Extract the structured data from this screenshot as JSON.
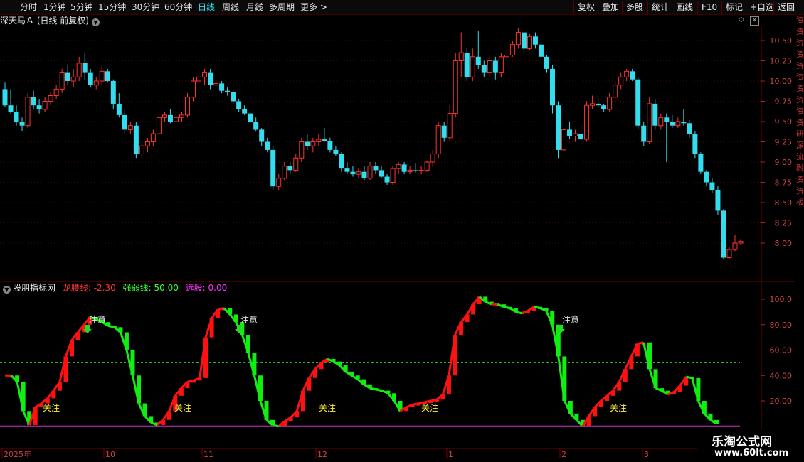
{
  "toolbar": {
    "timeframes": [
      "分时",
      "1分钟",
      "5分钟",
      "15分钟",
      "30分钟",
      "60分钟",
      "日线",
      "周线",
      "月线",
      "多周期",
      "更多 >"
    ],
    "active_timeframe": "日线",
    "right_buttons": [
      "复权",
      "叠加",
      "多股",
      "统计",
      "画线",
      "F10",
      "标记",
      "+自选",
      "返回"
    ]
  },
  "stock_title": "深天马Ａ (日线 前复权)",
  "main_axis_labels": [
    "10.50",
    "10.25",
    "10.00",
    "9.75",
    "9.50",
    "9.25",
    "9.00",
    "8.75",
    "8.50",
    "8.25",
    "8.00"
  ],
  "indicator": {
    "name": "股朋指标网",
    "lines": [
      {
        "label": "龙腰线:",
        "value": "-2.30",
        "color": "#ff3333"
      },
      {
        "label": "强弱线:",
        "value": "50.00",
        "color": "#33ff33"
      },
      {
        "label": "选股:",
        "value": "0.00",
        "color": "#ff33ff"
      }
    ],
    "axis_labels": [
      "100.0",
      "80.00",
      "60.00",
      "40.00",
      "20.00"
    ],
    "annotations": {
      "alert": "注意",
      "watch": "关注"
    }
  },
  "date_labels": [
    "2025年",
    "10",
    "11",
    "12",
    "1",
    "2",
    "3"
  ],
  "right_side_chars": "资资资资资资资资资资研深流融资资板",
  "watermark": {
    "line1": "乐淘公式网",
    "line2": "www.60lt.com"
  },
  "chart_data": [
    {
      "type": "candlestick",
      "title": "深天马Ａ (日线 前复权)",
      "ylim": [
        7.75,
        10.65
      ],
      "colors": {
        "up": "#ff3333",
        "down": "#33ddee"
      },
      "candles": [
        [
          9.9,
          9.98,
          9.68,
          9.7
        ],
        [
          9.7,
          9.9,
          9.6,
          9.62
        ],
        [
          9.62,
          9.7,
          9.45,
          9.5
        ],
        [
          9.5,
          9.55,
          9.38,
          9.45
        ],
        [
          9.45,
          9.85,
          9.42,
          9.8
        ],
        [
          9.8,
          9.88,
          9.65,
          9.7
        ],
        [
          9.7,
          9.78,
          9.6,
          9.65
        ],
        [
          9.65,
          9.8,
          9.62,
          9.75
        ],
        [
          9.75,
          9.86,
          9.7,
          9.82
        ],
        [
          9.82,
          9.95,
          9.78,
          9.9
        ],
        [
          9.9,
          10.15,
          9.85,
          10.1
        ],
        [
          10.1,
          10.2,
          9.95,
          10.0
        ],
        [
          10.0,
          10.15,
          9.92,
          10.05
        ],
        [
          10.05,
          10.3,
          10.0,
          10.22
        ],
        [
          10.22,
          10.35,
          10.02,
          10.1
        ],
        [
          10.1,
          10.15,
          9.92,
          9.95
        ],
        [
          9.95,
          10.05,
          9.9,
          10.0
        ],
        [
          10.0,
          10.2,
          9.95,
          10.12
        ],
        [
          10.12,
          10.15,
          9.98,
          10.0
        ],
        [
          10.0,
          10.02,
          9.65,
          9.72
        ],
        [
          9.72,
          9.85,
          9.55,
          9.58
        ],
        [
          9.58,
          9.65,
          9.35,
          9.4
        ],
        [
          9.4,
          9.5,
          9.35,
          9.45
        ],
        [
          9.45,
          9.5,
          9.05,
          9.1
        ],
        [
          9.1,
          9.25,
          9.05,
          9.2
        ],
        [
          9.2,
          9.3,
          9.12,
          9.25
        ],
        [
          9.25,
          9.4,
          9.2,
          9.35
        ],
        [
          9.35,
          9.6,
          9.32,
          9.55
        ],
        [
          9.55,
          9.62,
          9.5,
          9.58
        ],
        [
          9.58,
          9.65,
          9.48,
          9.5
        ],
        [
          9.5,
          9.6,
          9.45,
          9.55
        ],
        [
          9.55,
          9.62,
          9.5,
          9.58
        ],
        [
          9.58,
          9.85,
          9.55,
          9.8
        ],
        [
          9.8,
          10.05,
          9.75,
          10.0
        ],
        [
          10.0,
          10.1,
          9.9,
          10.05
        ],
        [
          10.05,
          10.15,
          9.95,
          10.1
        ],
        [
          10.1,
          10.15,
          9.9,
          9.95
        ],
        [
          9.95,
          10.0,
          9.93,
          9.97
        ],
        [
          9.97,
          10.0,
          9.85,
          9.88
        ],
        [
          9.88,
          9.92,
          9.82,
          9.86
        ],
        [
          9.86,
          9.9,
          9.72,
          9.75
        ],
        [
          9.75,
          9.78,
          9.62,
          9.65
        ],
        [
          9.65,
          9.7,
          9.58,
          9.6
        ],
        [
          9.6,
          9.62,
          9.48,
          9.5
        ],
        [
          9.5,
          9.55,
          9.38,
          9.4
        ],
        [
          9.4,
          9.42,
          9.2,
          9.25
        ],
        [
          9.25,
          9.3,
          9.12,
          9.15
        ],
        [
          9.15,
          9.2,
          8.65,
          8.7
        ],
        [
          8.7,
          8.85,
          8.65,
          8.8
        ],
        [
          8.8,
          9.0,
          8.78,
          8.95
        ],
        [
          8.95,
          9.0,
          8.85,
          8.9
        ],
        [
          8.9,
          9.1,
          8.88,
          9.05
        ],
        [
          9.05,
          9.3,
          9.0,
          9.25
        ],
        [
          9.25,
          9.35,
          9.15,
          9.2
        ],
        [
          9.2,
          9.3,
          9.12,
          9.25
        ],
        [
          9.25,
          9.35,
          9.2,
          9.28
        ],
        [
          9.28,
          9.42,
          9.25,
          9.26
        ],
        [
          9.26,
          9.3,
          9.12,
          9.15
        ],
        [
          9.15,
          9.2,
          9.08,
          9.1
        ],
        [
          9.1,
          9.12,
          8.88,
          8.92
        ],
        [
          8.92,
          9.0,
          8.85,
          8.88
        ],
        [
          8.88,
          8.95,
          8.82,
          8.85
        ],
        [
          8.85,
          8.92,
          8.8,
          8.88
        ],
        [
          8.88,
          8.95,
          8.78,
          8.8
        ],
        [
          8.8,
          9.0,
          8.78,
          8.95
        ],
        [
          8.95,
          9.0,
          8.85,
          8.9
        ],
        [
          8.9,
          8.95,
          8.8,
          8.82
        ],
        [
          8.82,
          8.85,
          8.72,
          8.75
        ],
        [
          8.75,
          8.95,
          8.72,
          8.92
        ],
        [
          8.92,
          9.0,
          8.85,
          8.97
        ],
        [
          8.97,
          9.0,
          8.85,
          8.88
        ],
        [
          8.88,
          8.95,
          8.85,
          8.9
        ],
        [
          8.9,
          8.98,
          8.87,
          8.89
        ],
        [
          8.89,
          8.95,
          8.85,
          8.9
        ],
        [
          8.9,
          9.02,
          8.88,
          9.0
        ],
        [
          9.0,
          9.15,
          8.95,
          9.1
        ],
        [
          9.1,
          9.5,
          9.05,
          9.45
        ],
        [
          9.45,
          9.5,
          9.25,
          9.3
        ],
        [
          9.3,
          9.7,
          9.25,
          9.6
        ],
        [
          9.6,
          10.35,
          9.55,
          10.25
        ],
        [
          10.25,
          10.6,
          10.05,
          10.35
        ],
        [
          10.35,
          10.4,
          10.0,
          10.05
        ],
        [
          10.05,
          10.4,
          10.0,
          10.3
        ],
        [
          10.3,
          10.62,
          10.15,
          10.2
        ],
        [
          10.2,
          10.25,
          10.05,
          10.1
        ],
        [
          10.1,
          10.3,
          10.05,
          10.25
        ],
        [
          10.25,
          10.3,
          10.02,
          10.1
        ],
        [
          10.1,
          10.35,
          10.05,
          10.3
        ],
        [
          10.3,
          10.38,
          10.25,
          10.32
        ],
        [
          10.32,
          10.5,
          10.3,
          10.45
        ],
        [
          10.45,
          10.65,
          10.4,
          10.6
        ],
        [
          10.6,
          10.62,
          10.35,
          10.4
        ],
        [
          10.4,
          10.58,
          10.38,
          10.55
        ],
        [
          10.55,
          10.6,
          10.4,
          10.45
        ],
        [
          10.45,
          10.48,
          10.25,
          10.3
        ],
        [
          10.3,
          10.32,
          10.1,
          10.15
        ],
        [
          10.15,
          10.2,
          9.6,
          9.7
        ],
        [
          9.7,
          9.75,
          9.05,
          9.15
        ],
        [
          9.15,
          9.45,
          9.1,
          9.4
        ],
        [
          9.4,
          9.5,
          9.28,
          9.32
        ],
        [
          9.32,
          9.4,
          9.25,
          9.35
        ],
        [
          9.35,
          9.48,
          9.25,
          9.28
        ],
        [
          9.28,
          9.75,
          9.25,
          9.7
        ],
        [
          9.7,
          9.82,
          9.65,
          9.72
        ],
        [
          9.72,
          9.78,
          9.68,
          9.7
        ],
        [
          9.7,
          9.72,
          9.62,
          9.65
        ],
        [
          9.65,
          9.85,
          9.62,
          9.8
        ],
        [
          9.8,
          10.0,
          9.75,
          9.95
        ],
        [
          9.95,
          10.1,
          9.9,
          10.05
        ],
        [
          10.05,
          10.15,
          10.0,
          10.12
        ],
        [
          10.12,
          10.15,
          10.0,
          10.02
        ],
        [
          10.02,
          10.05,
          9.4,
          9.45
        ],
        [
          9.45,
          9.5,
          9.2,
          9.25
        ],
        [
          9.25,
          9.8,
          9.22,
          9.72
        ],
        [
          9.72,
          9.78,
          9.4,
          9.45
        ],
        [
          9.45,
          9.6,
          9.4,
          9.55
        ],
        [
          9.55,
          9.6,
          9.0,
          9.5
        ],
        [
          9.5,
          9.58,
          9.42,
          9.45
        ],
        [
          9.45,
          9.55,
          9.42,
          9.5
        ],
        [
          9.5,
          9.65,
          9.45,
          9.48
        ],
        [
          9.48,
          9.52,
          9.3,
          9.35
        ],
        [
          9.35,
          9.38,
          9.05,
          9.1
        ],
        [
          9.1,
          9.12,
          8.85,
          8.88
        ],
        [
          8.88,
          8.9,
          8.7,
          8.75
        ],
        [
          8.75,
          8.8,
          8.62,
          8.65
        ],
        [
          8.65,
          8.7,
          8.35,
          8.4
        ],
        [
          8.4,
          8.42,
          7.8,
          7.82
        ],
        [
          7.82,
          7.95,
          7.8,
          7.92
        ],
        [
          7.92,
          8.1,
          7.9,
          8.0
        ],
        [
          8.0,
          8.05,
          7.98,
          8.02
        ]
      ]
    },
    {
      "type": "bar",
      "title": "股朋指标网",
      "ylim": [
        0,
        105
      ],
      "reference_lines": [
        {
          "name": "强弱线",
          "value": 50,
          "color": "#33ff33"
        },
        {
          "name": "选股",
          "value": 0,
          "color": "#ff33ff"
        }
      ],
      "colors": {
        "rising": "#ff1111",
        "falling": "#11ee11"
      },
      "values": [
        40,
        40,
        35,
        12,
        1,
        15,
        18,
        22,
        28,
        35,
        55,
        68,
        74,
        80,
        86,
        84,
        82,
        79,
        78,
        74,
        60,
        40,
        18,
        8,
        3,
        1,
        5,
        12,
        24,
        30,
        35,
        36,
        38,
        70,
        85,
        92,
        93,
        88,
        82,
        72,
        58,
        40,
        20,
        5,
        1,
        0,
        4,
        7,
        12,
        28,
        38,
        45,
        50,
        53,
        51,
        48,
        43,
        40,
        37,
        33,
        30,
        29,
        28,
        26,
        20,
        12,
        15,
        17,
        18,
        19,
        20,
        21,
        25,
        40,
        72,
        82,
        88,
        96,
        102,
        98,
        96,
        96,
        94,
        93,
        90,
        89,
        91,
        94,
        93,
        91,
        80,
        55,
        20,
        10,
        5,
        0,
        8,
        15,
        20,
        24,
        28,
        35,
        45,
        55,
        65,
        66,
        45,
        30,
        28,
        25,
        27,
        32,
        39,
        38,
        20,
        10,
        5,
        2
      ]
    }
  ]
}
